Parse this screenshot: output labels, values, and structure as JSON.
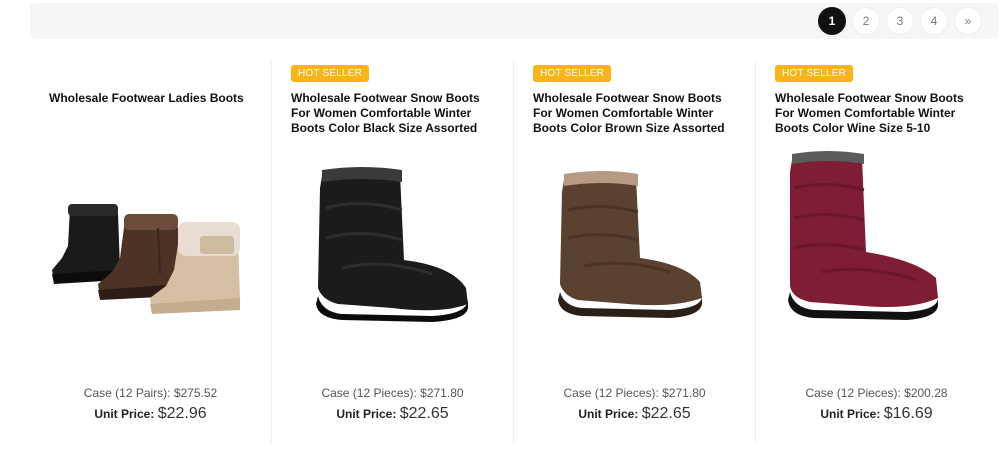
{
  "pagination": {
    "pages": [
      "1",
      "2",
      "3",
      "4"
    ],
    "active": "1",
    "next": "»"
  },
  "products": [
    {
      "badge": "",
      "title": "Wholesale Footwear Ladies Boots",
      "case_price": "Case (12 Pairs): $275.52",
      "unit_label": "Unit Price:",
      "unit_price": "$22.96",
      "image": "three-boots-image"
    },
    {
      "badge": "HOT SELLER",
      "title": "Wholesale Footwear Snow Boots For Women Comfortable Winter Boots Color Black Size Assorted",
      "case_price": "Case (12 Pieces): $271.80",
      "unit_label": "Unit Price:",
      "unit_price": "$22.65",
      "image": "black-boot-image",
      "color": "#1b1b1d"
    },
    {
      "badge": "HOT SELLER",
      "title": "Wholesale Footwear Snow Boots For Women Comfortable Winter Boots Color Brown Size Assorted",
      "case_price": "Case (12 Pieces): $271.80",
      "unit_label": "Unit Price:",
      "unit_price": "$22.65",
      "image": "brown-boot-image",
      "color": "#5a4130"
    },
    {
      "badge": "HOT SELLER",
      "title": "Wholesale Footwear Snow Boots For Women Comfortable Winter Boots Color Wine Size 5-10",
      "case_price": "Case (12 Pieces): $200.28",
      "unit_label": "Unit Price:",
      "unit_price": "$16.69",
      "image": "wine-boot-image",
      "color": "#7e1d34"
    }
  ],
  "colors": {
    "badge": "#f9b418",
    "active_page": "#111111"
  }
}
